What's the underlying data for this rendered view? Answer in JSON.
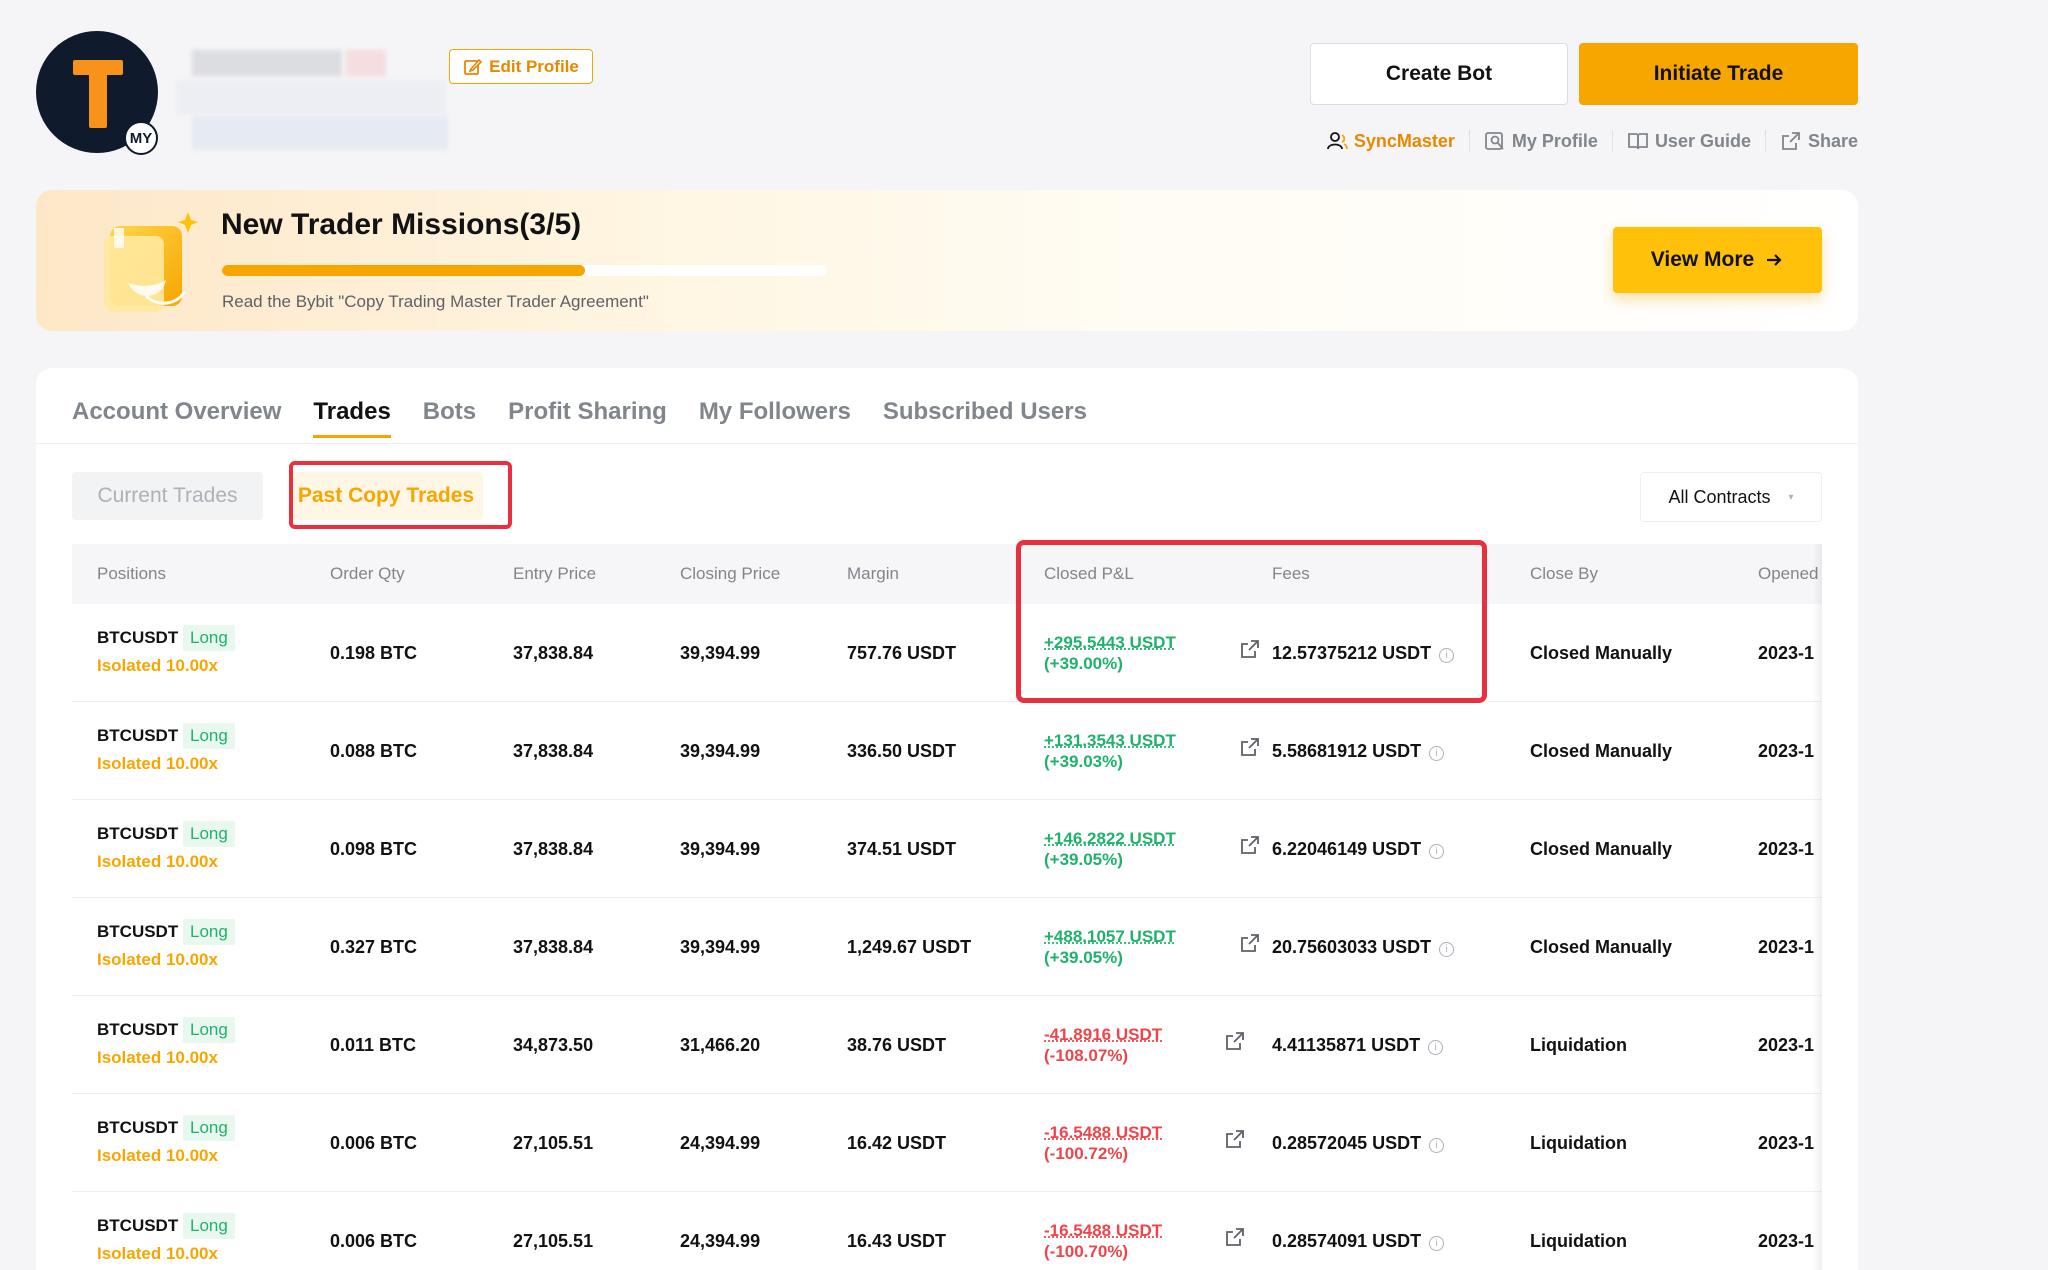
{
  "avatar": {
    "badge": "MY"
  },
  "header": {
    "edit_profile": "Edit Profile",
    "create_bot": "Create Bot",
    "initiate_trade": "Initiate Trade",
    "links": [
      {
        "label": "SyncMaster",
        "icon": "user-icon"
      },
      {
        "label": "My Profile",
        "icon": "profile-search-icon"
      },
      {
        "label": "User Guide",
        "icon": "book-icon"
      },
      {
        "label": "Share",
        "icon": "external-link-icon"
      }
    ]
  },
  "missions": {
    "title": "New Trader Missions(3/5)",
    "progress_fraction": 0.6,
    "description": "Read the Bybit \"Copy Trading Master Trader Agreement\"",
    "view_more": "View More"
  },
  "tabs": [
    "Account Overview",
    "Trades",
    "Bots",
    "Profit Sharing",
    "My Followers",
    "Subscribed Users"
  ],
  "active_tab": "Trades",
  "subtabs": {
    "current": "Current Trades",
    "past": "Past Copy Trades",
    "contracts": "All Contracts"
  },
  "table": {
    "columns": [
      "Positions",
      "Order Qty",
      "Entry Price",
      "Closing Price",
      "Margin",
      "Closed P&L",
      "Fees",
      "Close By",
      "Opened"
    ],
    "rows": [
      {
        "symbol": "BTCUSDT",
        "side": "Long",
        "leverage": "Isolated 10.00x",
        "qty": "0.198 BTC",
        "entry": "37,838.84",
        "closing": "39,394.99",
        "margin": "757.76 USDT",
        "pnl": "+295.5443 USDT",
        "pnl_pct": "(+39.00%)",
        "pnl_sign": "pos",
        "fees": "12.57375212 USDT",
        "close_by": "Closed Manually",
        "opened": "2023-1"
      },
      {
        "symbol": "BTCUSDT",
        "side": "Long",
        "leverage": "Isolated 10.00x",
        "qty": "0.088 BTC",
        "entry": "37,838.84",
        "closing": "39,394.99",
        "margin": "336.50 USDT",
        "pnl": "+131.3543 USDT",
        "pnl_pct": "(+39.03%)",
        "pnl_sign": "pos",
        "fees": "5.58681912 USDT",
        "close_by": "Closed Manually",
        "opened": "2023-1"
      },
      {
        "symbol": "BTCUSDT",
        "side": "Long",
        "leverage": "Isolated 10.00x",
        "qty": "0.098 BTC",
        "entry": "37,838.84",
        "closing": "39,394.99",
        "margin": "374.51 USDT",
        "pnl": "+146.2822 USDT",
        "pnl_pct": "(+39.05%)",
        "pnl_sign": "pos",
        "fees": "6.22046149 USDT",
        "close_by": "Closed Manually",
        "opened": "2023-1"
      },
      {
        "symbol": "BTCUSDT",
        "side": "Long",
        "leverage": "Isolated 10.00x",
        "qty": "0.327 BTC",
        "entry": "37,838.84",
        "closing": "39,394.99",
        "margin": "1,249.67 USDT",
        "pnl": "+488.1057 USDT",
        "pnl_pct": "(+39.05%)",
        "pnl_sign": "pos",
        "fees": "20.75603033 USDT",
        "close_by": "Closed Manually",
        "opened": "2023-1"
      },
      {
        "symbol": "BTCUSDT",
        "side": "Long",
        "leverage": "Isolated 10.00x",
        "qty": "0.011 BTC",
        "entry": "34,873.50",
        "closing": "31,466.20",
        "margin": "38.76 USDT",
        "pnl": "-41.8916 USDT",
        "pnl_pct": "(-108.07%)",
        "pnl_sign": "neg",
        "fees": "4.41135871 USDT",
        "close_by": "Liquidation",
        "opened": "2023-1"
      },
      {
        "symbol": "BTCUSDT",
        "side": "Long",
        "leverage": "Isolated 10.00x",
        "qty": "0.006 BTC",
        "entry": "27,105.51",
        "closing": "24,394.99",
        "margin": "16.42 USDT",
        "pnl": "-16.5488 USDT",
        "pnl_pct": "(-100.72%)",
        "pnl_sign": "neg",
        "fees": "0.28572045 USDT",
        "close_by": "Liquidation",
        "opened": "2023-1"
      },
      {
        "symbol": "BTCUSDT",
        "side": "Long",
        "leverage": "Isolated 10.00x",
        "qty": "0.006 BTC",
        "entry": "27,105.51",
        "closing": "24,394.99",
        "margin": "16.43 USDT",
        "pnl": "-16.5488 USDT",
        "pnl_pct": "(-100.70%)",
        "pnl_sign": "neg",
        "fees": "0.28574091 USDT",
        "close_by": "Liquidation",
        "opened": "2023-1"
      }
    ]
  },
  "colors": {
    "accent": "#f7a600",
    "positive": "#20b26c",
    "negative": "#ef454a",
    "highlight": "#e8303e"
  }
}
